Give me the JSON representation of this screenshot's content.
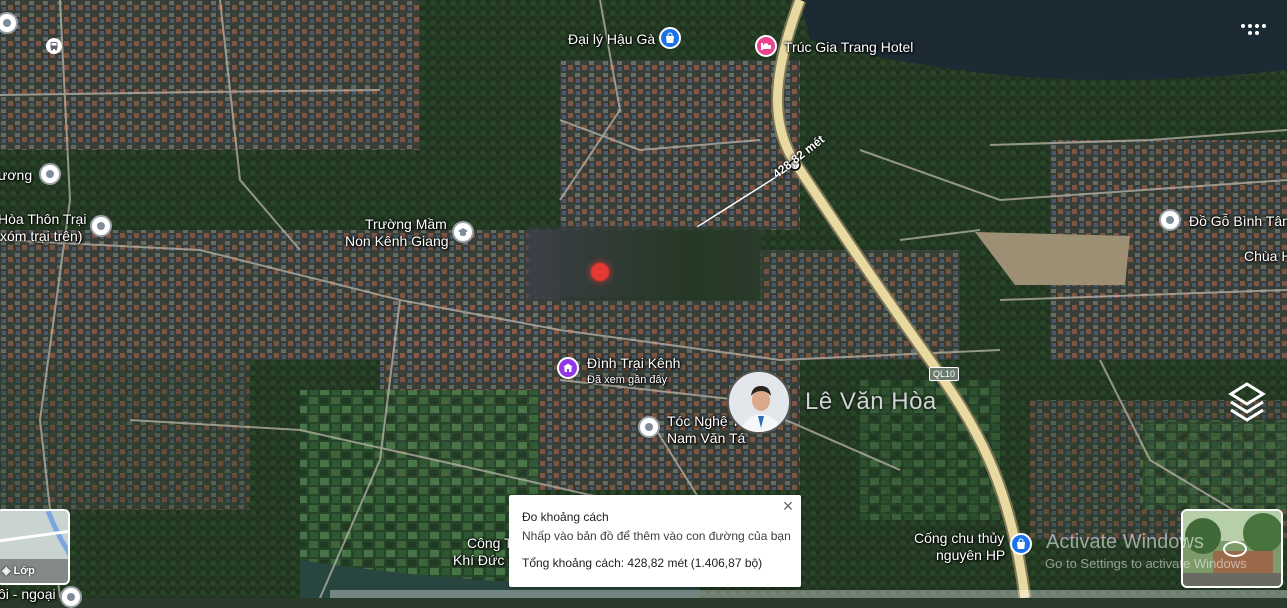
{
  "map": {
    "type": "satellite",
    "road_color": "#e8d9a0",
    "ui_accent": "#1a73e8"
  },
  "places": [
    {
      "label": "Đại lý Hậu Gà",
      "icon": "shopping-bag-icon"
    },
    {
      "label": "Trúc Gia Trang Hotel",
      "icon": "hotel-bed-icon"
    },
    {
      "label": "ương",
      "icon": "place-icon"
    },
    {
      "label": "Hòa Thôn Trại",
      "icon": "place-icon"
    },
    {
      "label": "xóm trại trên)",
      "icon": ""
    },
    {
      "label": "Trường Mầm",
      "icon": "school-icon"
    },
    {
      "label": "Non Kênh Giang",
      "icon": ""
    },
    {
      "label": "Đồ Gỗ Bình Tâm",
      "icon": "place-icon"
    },
    {
      "label": "Chùa H",
      "icon": ""
    },
    {
      "label": "Đình Trại Kênh",
      "icon": "temple-icon"
    },
    {
      "label": "Đã xem gần đây",
      "icon": ""
    },
    {
      "label": "Tóc Nghệ T",
      "icon": "place-icon"
    },
    {
      "label": "Nam Văn Tá",
      "icon": ""
    },
    {
      "label": "Cống chu thủy",
      "icon": "shopping-bag-icon"
    },
    {
      "label": "nguyên HP",
      "icon": ""
    },
    {
      "label": "Công T",
      "icon": ""
    },
    {
      "label": "Khí Đức N",
      "icon": ""
    },
    {
      "label": "ôi - ngoại",
      "icon": ""
    }
  ],
  "route_label": "QL10",
  "measure": {
    "segment_label": "428,82 mét"
  },
  "user_overlay": {
    "name": "Lê Văn Hòa"
  },
  "popup": {
    "title": "Đo khoảng cách",
    "hint": "Nhấp vào bản đồ để thêm vào con đường của bạn",
    "total": "Tổng khoảng cách: 428,82 mét (1.406,87 bộ)",
    "close": "×"
  },
  "layers_button": {
    "label": "Lớp"
  },
  "watermark": {
    "line1": "Activate Windows",
    "line2": "Go to Settings to activate Windows"
  }
}
